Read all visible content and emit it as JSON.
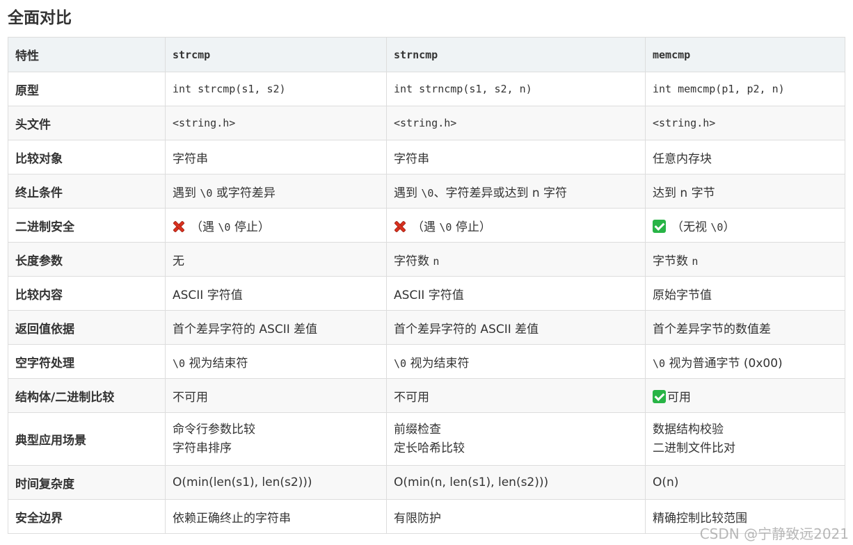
{
  "heading": "全面对比",
  "header": {
    "col0": "特性",
    "col1": "strcmp",
    "col2": "strncmp",
    "col3": "memcmp"
  },
  "rows": [
    {
      "label": "原型",
      "c1": "int strcmp(s1, s2)",
      "c2": "int strncmp(s1, s2, n)",
      "c3": "int memcmp(p1, p2, n)"
    },
    {
      "label": "头文件",
      "c1": "<string.h>",
      "c2": "<string.h>",
      "c3": "<string.h>"
    },
    {
      "label": "比较对象",
      "c1": "字符串",
      "c2": "字符串",
      "c3": "任意内存块"
    },
    {
      "label": "终止条件",
      "c1_code": "\\0",
      "c1_pre": "遇到 ",
      "c1_post": " 或字符差异",
      "c2_pre": "遇到 ",
      "c2_code": "\\0",
      "c2_post": "、字符差异或达到 n 字符",
      "c3": "达到 n 字节"
    },
    {
      "label": "二进制安全",
      "c1_pre": "（遇 ",
      "c1_code": "\\0",
      "c1_post": " 停止）",
      "c1_icon": "cross-mark-icon",
      "c2_pre": "（遇 ",
      "c2_code": "\\0",
      "c2_post": " 停止）",
      "c2_icon": "cross-mark-icon",
      "c3_pre": "（无视 ",
      "c3_code": "\\0",
      "c3_post": "）",
      "c3_icon": "check-mark-icon"
    },
    {
      "label": "长度参数",
      "c1": "无",
      "c2_pre": "字符数 ",
      "c2_code": "n",
      "c3_pre": "字节数 ",
      "c3_code": "n"
    },
    {
      "label": "比较内容",
      "c1": "ASCII 字符值",
      "c2": "ASCII 字符值",
      "c3": "原始字节值"
    },
    {
      "label": "返回值依据",
      "c1": "首个差异字符的 ASCII 差值",
      "c2": "首个差异字符的 ASCII 差值",
      "c3": "首个差异字节的数值差"
    },
    {
      "label": "空字符处理",
      "c1_code": "\\0",
      "c1_post": " 视为结束符",
      "c2_code": "\\0",
      "c2_post": " 视为结束符",
      "c3_code": "\\0",
      "c3_post": " 视为普通字节 (0x00)"
    },
    {
      "label": "结构体/二进制比较",
      "c1": "不可用",
      "c2": "不可用",
      "c3": "可用",
      "c3_icon": "check-mark-icon"
    },
    {
      "label": "典型应用场景",
      "c1_l1": "命令行参数比较",
      "c1_l2": "字符串排序",
      "c2_l1": "前缀检查",
      "c2_l2": "定长哈希比较",
      "c3_l1": "数据结构校验",
      "c3_l2": "二进制文件比对"
    },
    {
      "label": "时间复杂度",
      "c1": "O(min(len(s1), len(s2)))",
      "c2": "O(min(n, len(s1), len(s2)))",
      "c3": "O(n)"
    },
    {
      "label": "安全边界",
      "c1": "依赖正确终止的字符串",
      "c2": "有限防护",
      "c3": "精确控制比较范围"
    }
  ],
  "watermark": "CSDN @宁静致远2021",
  "colors": {
    "header_bg": "#eff3f5",
    "border": "#dddddd",
    "cross": "#d8311f",
    "check": "#28b446"
  }
}
